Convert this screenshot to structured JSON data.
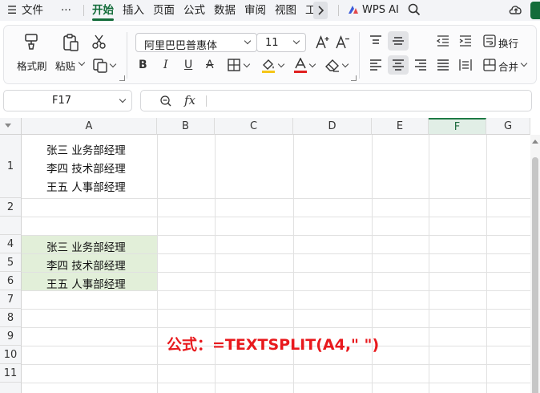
{
  "menu": {
    "file_label": "文件",
    "more_label": "···",
    "tabs": [
      "开始",
      "插入",
      "页面",
      "公式",
      "数据",
      "审阅",
      "视图",
      "工"
    ],
    "active_tab": "开始",
    "wps_ai_label": "WPS AI"
  },
  "ribbon": {
    "format_painter_label": "格式刷",
    "paste_label": "粘贴",
    "font_name": "阿里巴巴普惠体",
    "font_size": "11",
    "wrap_label": "换行",
    "merge_label": "合并"
  },
  "formula_bar": {
    "name_box": "F17",
    "fx_label": "fx",
    "content": ""
  },
  "sheet": {
    "columns": [
      "A",
      "B",
      "C",
      "D",
      "E",
      "F",
      "G"
    ],
    "selected_column": "F",
    "rows": [
      "1",
      "2",
      "4",
      "5",
      "6",
      "7",
      "8",
      "9",
      "10",
      "11"
    ],
    "a1_lines": [
      "张三 业务部经理",
      "李四 技术部经理",
      "王五 人事部经理"
    ],
    "a4": "张三 业务部经理",
    "a5": "李四 技术部经理",
    "a6": "王五 人事部经理",
    "highlight_color": "#e2efd9",
    "note": "公式：=TEXTSPLIT(A4,\" \")",
    "note_color": "#e8191d"
  }
}
